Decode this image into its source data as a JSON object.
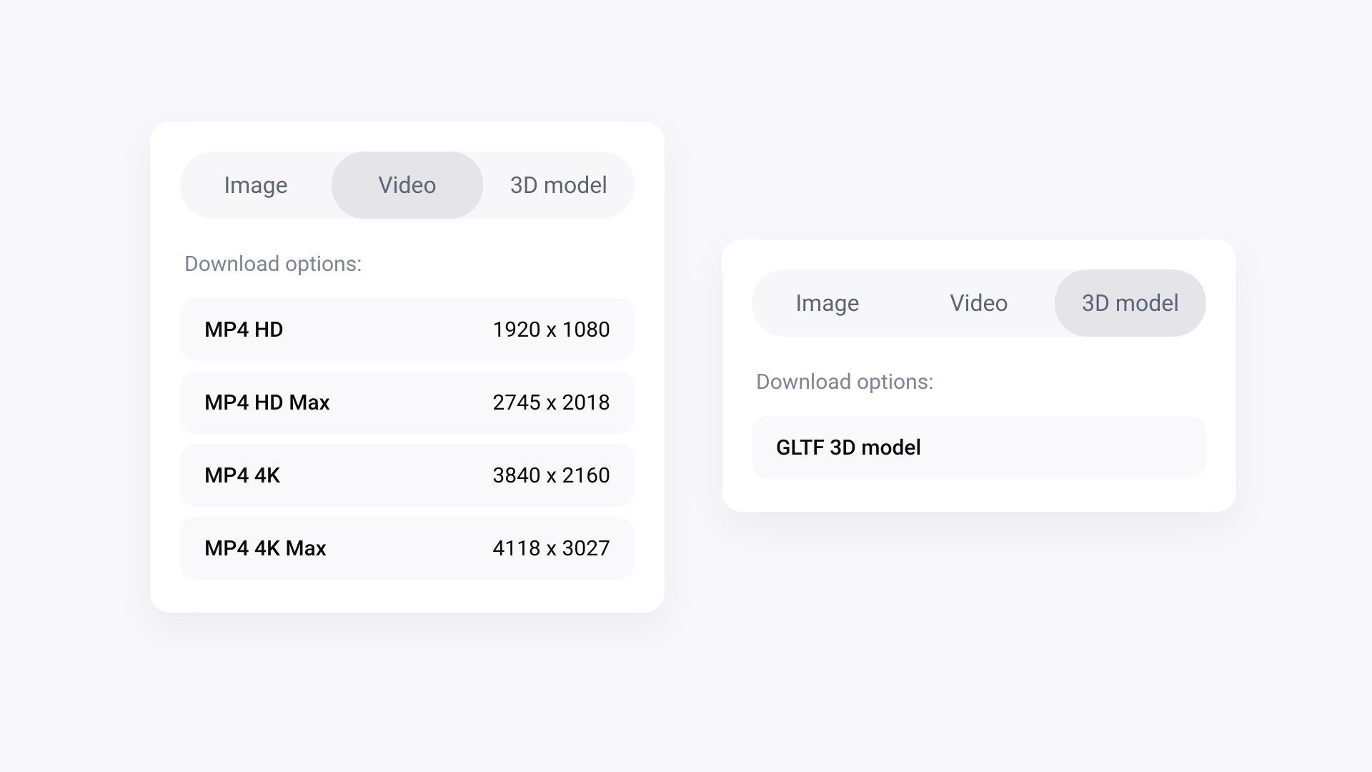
{
  "leftPanel": {
    "tabs": [
      {
        "label": "Image",
        "active": false
      },
      {
        "label": "Video",
        "active": true
      },
      {
        "label": "3D model",
        "active": false
      }
    ],
    "sectionLabel": "Download options:",
    "options": [
      {
        "name": "MP4 HD",
        "spec": "1920 x 1080"
      },
      {
        "name": "MP4 HD Max",
        "spec": "2745 x 2018"
      },
      {
        "name": "MP4 4K",
        "spec": "3840 x 2160"
      },
      {
        "name": "MP4 4K Max",
        "spec": "4118 x 3027"
      }
    ]
  },
  "rightPanel": {
    "tabs": [
      {
        "label": "Image",
        "active": false
      },
      {
        "label": "Video",
        "active": false
      },
      {
        "label": "3D model",
        "active": true
      }
    ],
    "sectionLabel": "Download options:",
    "options": [
      {
        "name": "GLTF 3D model",
        "spec": ""
      }
    ]
  }
}
